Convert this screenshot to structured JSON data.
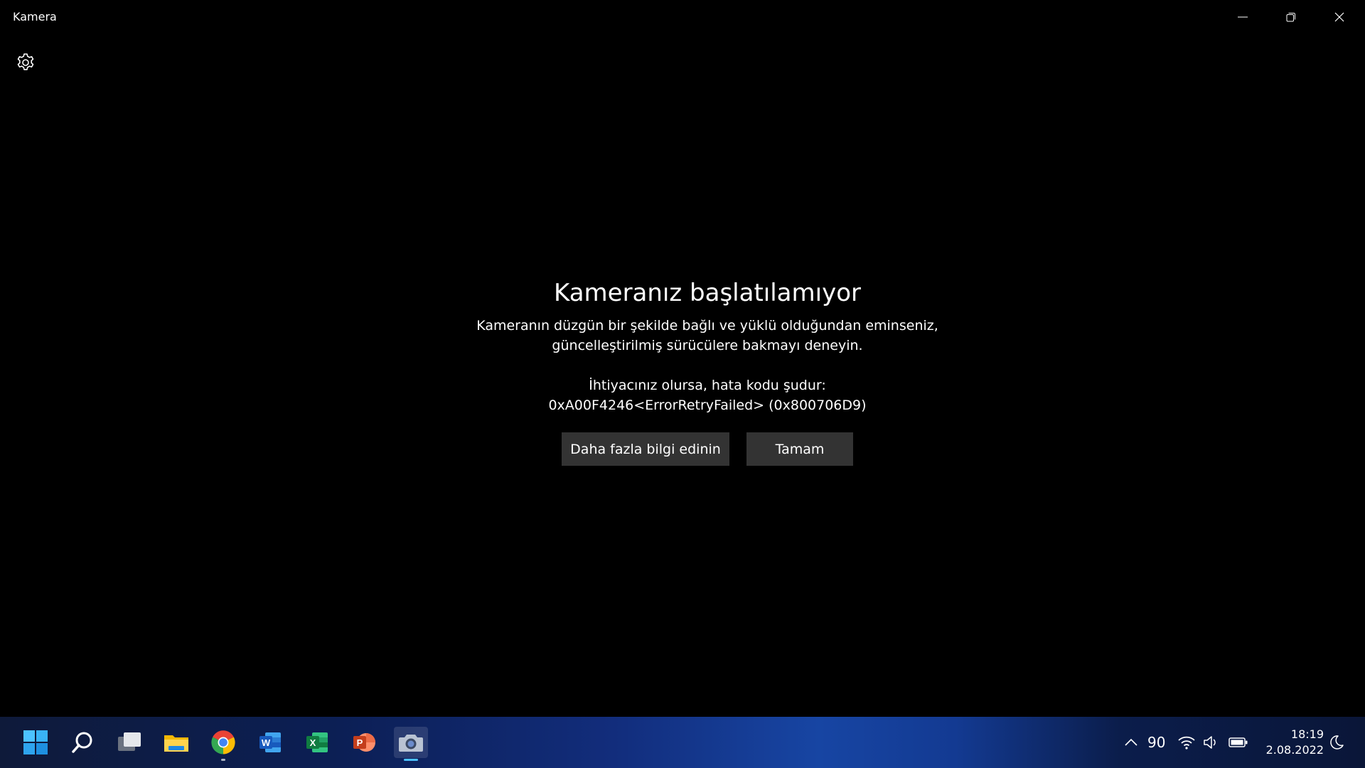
{
  "window": {
    "title": "Kamera"
  },
  "error": {
    "title": "Kameranız başlatılamıyor",
    "description_line1": "Kameranın düzgün bir şekilde bağlı ve yüklü olduğundan eminseniz,",
    "description_line2": "güncelleştirilmiş sürücülere bakmayı deneyin.",
    "code_intro": "İhtiyacınız olursa, hata kodu şudur:",
    "code": "0xA00F4246<ErrorRetryFailed> (0x800706D9)",
    "more_info_button": "Daha fazla bilgi edinin",
    "ok_button": "Tamam"
  },
  "taskbar": {
    "apps": [
      {
        "name": "start-icon"
      },
      {
        "name": "search-icon"
      },
      {
        "name": "task-view-icon"
      },
      {
        "name": "file-explorer-icon"
      },
      {
        "name": "chrome-icon"
      },
      {
        "name": "word-icon"
      },
      {
        "name": "excel-icon"
      },
      {
        "name": "powerpoint-icon"
      },
      {
        "name": "camera-icon"
      }
    ],
    "tray": {
      "number": "90",
      "time": "18:19",
      "date": "2.08.2022"
    }
  },
  "colors": {
    "background": "#000000",
    "button_bg": "#333333",
    "accent": "#4cc2ff"
  }
}
